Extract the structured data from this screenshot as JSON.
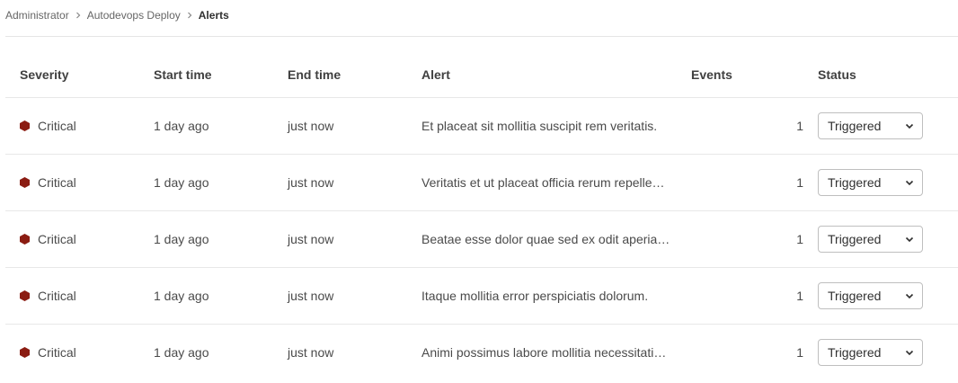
{
  "breadcrumb": {
    "items": [
      "Administrator",
      "Autodevops Deploy",
      "Alerts"
    ]
  },
  "table": {
    "columns": {
      "severity": "Severity",
      "start_time": "Start time",
      "end_time": "End time",
      "alert": "Alert",
      "events": "Events",
      "status": "Status"
    },
    "rows": [
      {
        "severity": "Critical",
        "start_time": "1 day ago",
        "end_time": "just now",
        "alert": "Et placeat sit mollitia suscipit rem veritatis.",
        "events": "1",
        "status": "Triggered"
      },
      {
        "severity": "Critical",
        "start_time": "1 day ago",
        "end_time": "just now",
        "alert": "Veritatis et ut placeat officia rerum repelle…",
        "events": "1",
        "status": "Triggered"
      },
      {
        "severity": "Critical",
        "start_time": "1 day ago",
        "end_time": "just now",
        "alert": "Beatae esse dolor quae sed ex odit aperia…",
        "events": "1",
        "status": "Triggered"
      },
      {
        "severity": "Critical",
        "start_time": "1 day ago",
        "end_time": "just now",
        "alert": "Itaque mollitia error perspiciatis dolorum.",
        "events": "1",
        "status": "Triggered"
      },
      {
        "severity": "Critical",
        "start_time": "1 day ago",
        "end_time": "just now",
        "alert": "Animi possimus labore mollitia necessitati…",
        "events": "1",
        "status": "Triggered"
      }
    ]
  },
  "colors": {
    "critical": "#8b1c12"
  },
  "icons": {
    "breadcrumb_separator": "chevron-right-icon",
    "severity": "severity-critical-icon",
    "dropdown": "chevron-down-icon"
  }
}
